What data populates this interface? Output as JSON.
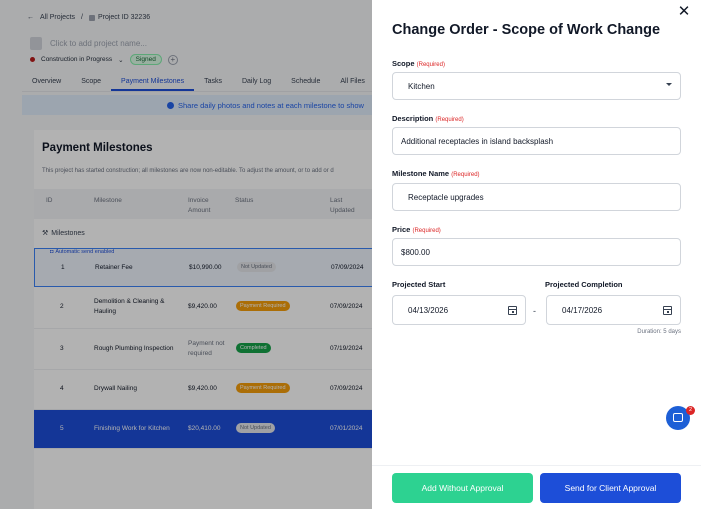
{
  "breadcrumb": {
    "back": "All Projects",
    "sep": "/",
    "project_id": "Project ID 32236"
  },
  "project": {
    "name_placeholder": "Click to add project name...",
    "status": "Construction in Progress",
    "signed": "Signed"
  },
  "tabs": [
    "Overview",
    "Scope",
    "Payment Milestones",
    "Tasks",
    "Daily Log",
    "Schedule",
    "All Files"
  ],
  "banner": "Share daily photos and notes at each milestone to show",
  "milestones": {
    "title": "Payment Milestones",
    "note": "This project has started construction; all milestones are now non-editable. To adjust the amount, or to add or d",
    "columns": {
      "id": "ID",
      "milestone": "Milestone",
      "invoice": "Invoice",
      "invoice2": "Amount",
      "status": "Status",
      "last": "Last",
      "last2": "Updated"
    },
    "section": "Milestones",
    "auto_send": "Automatic send enabled",
    "rows": [
      {
        "id": "1",
        "name": "Retainer Fee",
        "name2": "",
        "amount": "$10,990.00",
        "amount2": "",
        "status": "Not Updated",
        "status_color": "grey",
        "date": "07/09/2024"
      },
      {
        "id": "2",
        "name": "Demolition & Cleaning &",
        "name2": "Hauling",
        "amount": "$9,420.00",
        "amount2": "",
        "status": "Payment Required",
        "status_color": "amber",
        "date": "07/09/2024"
      },
      {
        "id": "3",
        "name": "Rough Plumbing Inspection",
        "name2": "",
        "amount": "Payment not",
        "amount2": "required",
        "status": "Completed",
        "status_color": "green",
        "date": "07/19/2024"
      },
      {
        "id": "4",
        "name": "Drywall Nailing",
        "name2": "",
        "amount": "$9,420.00",
        "amount2": "",
        "status": "Payment Required",
        "status_color": "amber",
        "date": "07/09/2024"
      },
      {
        "id": "5",
        "name": "Finishing Work for Kitchen",
        "name2": "",
        "amount": "$20,410.00",
        "amount2": "",
        "status": "Not Updated",
        "status_color": "grey",
        "date": "07/01/2024"
      }
    ]
  },
  "modal": {
    "title": "Change Order - Scope of Work Change",
    "required": "(Required)",
    "scope_label": "Scope",
    "scope_value": "Kitchen",
    "description_label": "Description",
    "description_value": "Additional receptacles in island backsplash",
    "milestone_label": "Milestone Name",
    "milestone_value": "Receptacle upgrades",
    "price_label": "Price",
    "price_value": "$800.00",
    "start_label": "Projected Start",
    "start_value": "04/13/2026",
    "dash": "-",
    "completion_label": "Projected Completion",
    "completion_value": "04/17/2026",
    "duration": "Duration: 5 days",
    "btn_add": "Add Without Approval",
    "btn_send": "Send for Client Approval",
    "chat_badge": "2"
  }
}
